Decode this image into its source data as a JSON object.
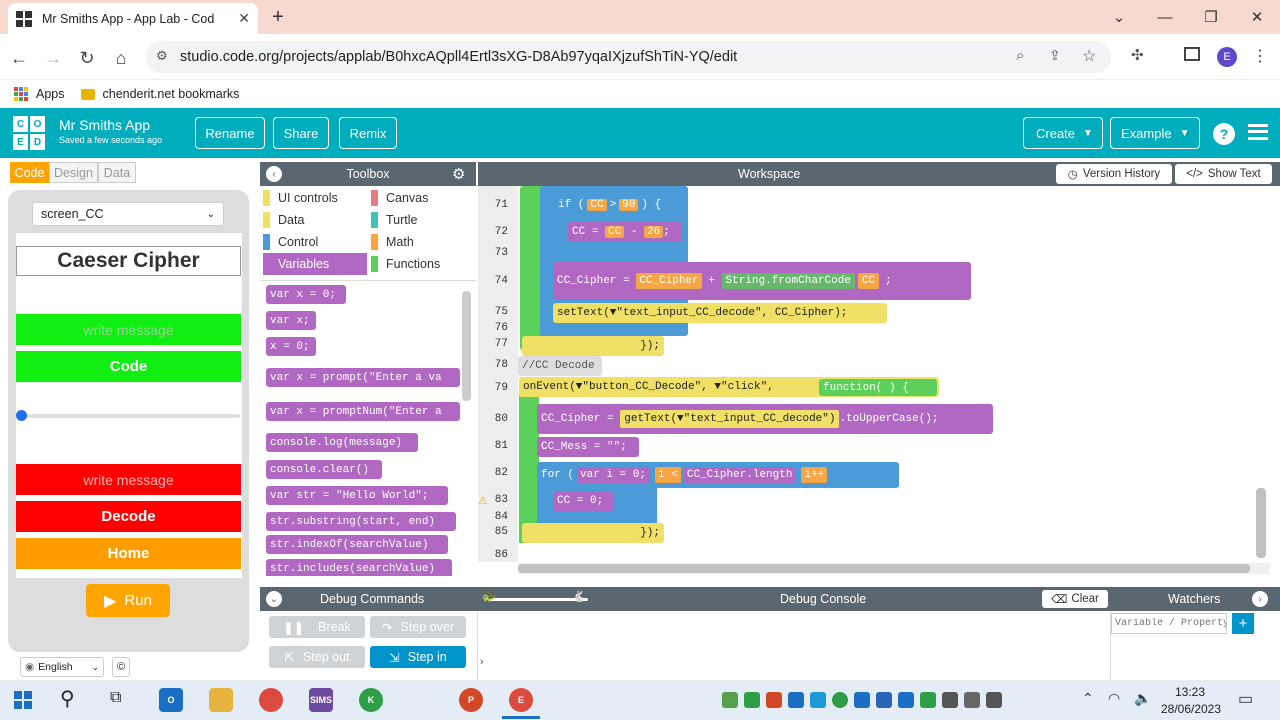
{
  "browser": {
    "tab_title": "Mr Smiths App - App Lab - Cod",
    "url": "studio.code.org/projects/applab/B0hxcAQpll4Ertl3sXG-D8Ab97yqaIXjzufShTiN-YQ/edit",
    "new_tab": "+",
    "bookmarks": [
      {
        "label": "Apps"
      },
      {
        "label": "chenderit.net bookmarks"
      }
    ],
    "profile_initial": "E"
  },
  "app": {
    "logo_letters": [
      "C",
      "O",
      "D",
      "E",
      "",
      "",
      ""
    ],
    "name": "Mr Smiths App",
    "saved": "Saved a few seconds ago",
    "rename": "Rename",
    "share": "Share",
    "remix": "Remix",
    "create": "Create",
    "example": "Example",
    "help": "?"
  },
  "left": {
    "tabs": [
      "Code",
      "Design",
      "Data"
    ],
    "screen_select": "screen_CC",
    "screen_title": "Caeser Cipher",
    "input1_placeholder": "write message",
    "code_btn": "Code",
    "input2_placeholder": "write message",
    "decode_btn": "Decode",
    "home_btn": "Home",
    "slider_value": 0,
    "run": "Run",
    "language": "English",
    "copyright": "©"
  },
  "toolbox": {
    "title": "Toolbox",
    "categories": [
      {
        "label": "UI controls",
        "color": "#f0e166"
      },
      {
        "label": "Canvas",
        "color": "#e47c84"
      },
      {
        "label": "Data",
        "color": "#f0e166"
      },
      {
        "label": "Turtle",
        "color": "#3ec4b5"
      },
      {
        "label": "Control",
        "color": "#4a9bd8"
      },
      {
        "label": "Math",
        "color": "#f7a643"
      },
      {
        "label": "Variables",
        "color": "#b168c3"
      },
      {
        "label": "Functions",
        "color": "#5bd05b"
      }
    ],
    "blocks": [
      "var x = 0;",
      "var x;",
      "x = 0;",
      "var x = prompt(\"Enter a va",
      "var x = promptNum(\"Enter a",
      "console.log(message)",
      "console.clear()",
      "var str = \"Hello World\";",
      "str.substring(start, end)",
      "str.indexOf(searchValue)",
      "str.includes(searchValue)"
    ]
  },
  "workspace": {
    "title": "Workspace",
    "version_history": "Version History",
    "show_text": "Show Text",
    "lines": [
      {
        "n": "71",
        "code": "if ( CC > 90 ) {"
      },
      {
        "n": "72",
        "code": "CC = CC - 26 ;"
      },
      {
        "n": "73",
        "code": "}"
      },
      {
        "n": "74",
        "code": "CC_Cipher = CC_Cipher + String.fromCharCode(CC) ;"
      },
      {
        "n": "75",
        "code": "setText(\"text_input_CC_decode\", CC_Cipher);"
      },
      {
        "n": "76",
        "code": "}"
      },
      {
        "n": "77",
        "code": "});"
      },
      {
        "n": "78",
        "code": "//CC Decode"
      },
      {
        "n": "79",
        "code": "onEvent(\"button_CC_Decode\", \"click\", function( ) {"
      },
      {
        "n": "80",
        "code": "CC_Cipher = getText(\"text_input_CC_decode\").toUpperCase();"
      },
      {
        "n": "81",
        "code": "CC_Mess = \"\";"
      },
      {
        "n": "82",
        "code": "for (var i = 0; i < CC_Cipher.length; i++) {"
      },
      {
        "n": "83",
        "code": "CC = 0;"
      },
      {
        "n": "84",
        "code": "}"
      },
      {
        "n": "85",
        "code": "});"
      },
      {
        "n": "86",
        "code": ""
      }
    ],
    "frag": {
      "if_kw": "if (",
      "cc": "CC",
      "gt": ">",
      "n90": "90",
      "close_brace": ") {",
      "eq": "=",
      "minus": "-",
      "n26": "26",
      "semi": ";",
      "cc_cipher": "CC_Cipher",
      "plus": "+",
      "string_from": "String.fromCharCode",
      "settext": "setText(▼\"text_input_CC_decode\", CC_Cipher);",
      "end_fn": "});",
      "comment": "//CC Decode",
      "onevent": "onEvent(▼\"button_CC_Decode\", ▼\"click\",",
      "function": "function( ) {",
      "gettext": "getText(▼\"text_input_CC_decode\")",
      "upper": ".toUpperCase();",
      "cc_mess": "CC_Mess = \"\";",
      "for_kw": "for (",
      "var_i": "var i = 0;",
      "i_lt": "i <",
      "length": "CC_Cipher.length",
      "ipp": "i++",
      "cc_zero": "CC = 0;"
    }
  },
  "debug": {
    "commands": "Debug Commands",
    "console": "Debug Console",
    "clear": "Clear",
    "watchers": "Watchers",
    "break": "Break",
    "step_over": "Step over",
    "step_out": "Step out",
    "step_in": "Step in",
    "watch_placeholder": "Variable / Property",
    "prompt": "›"
  },
  "taskbar": {
    "time": "13:23",
    "date": "28/06/2023",
    "apps": [
      {
        "name": "outlook-icon",
        "color": "#1a6fc4",
        "text": "O"
      },
      {
        "name": "file-explorer-icon",
        "color": "#e6b43c",
        "text": ""
      },
      {
        "name": "chrome-icon",
        "color": "#dd4b3e",
        "text": ""
      },
      {
        "name": "sims-icon",
        "color": "#6b4aa0",
        "text": "SIMS"
      },
      {
        "name": "chrome-k-icon",
        "color": "#2f9e44",
        "text": "K"
      },
      {
        "name": "powerpoint-icon",
        "color": "#d24726",
        "text": "P"
      },
      {
        "name": "chrome-active-icon",
        "color": "#dd4b3e",
        "text": "E"
      }
    ]
  }
}
